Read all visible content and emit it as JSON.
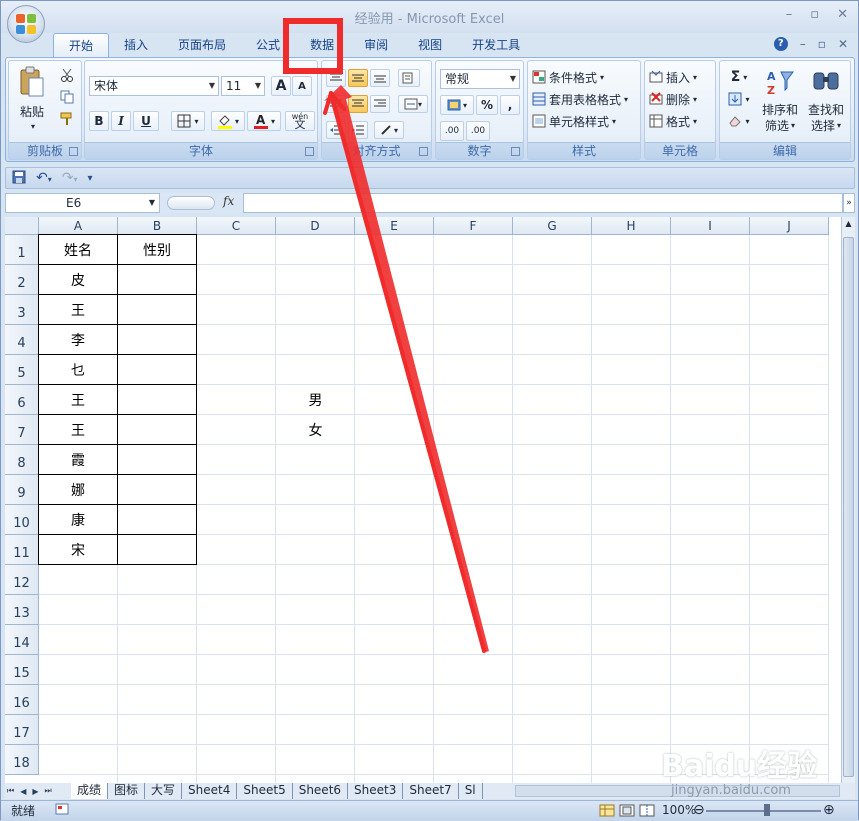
{
  "window": {
    "title": "经验用 - Microsoft Excel",
    "controls": [
      "–",
      "▫",
      "✕"
    ]
  },
  "ribbon_tabs": [
    "开始",
    "插入",
    "页面布局",
    "公式",
    "数据",
    "审阅",
    "视图",
    "开发工具"
  ],
  "ribbon": {
    "clipboard": {
      "label": "剪贴板",
      "paste": "粘贴"
    },
    "font": {
      "label": "字体",
      "font_name": "宋体",
      "font_size": "11",
      "grow": "A",
      "shrink": "A",
      "bold": "B",
      "italic": "I",
      "underline": "U",
      "phonetic": "wén",
      "phonetic_char": "文"
    },
    "alignment": {
      "label": "对齐方式"
    },
    "number": {
      "label": "数字",
      "format": "常规",
      "percent": "%",
      "comma": ",",
      "inc_decimal": ".00",
      "dec_decimal": ".00"
    },
    "styles": {
      "label": "样式",
      "conditional": "条件格式",
      "table": "套用表格格式",
      "cell_styles": "单元格样式"
    },
    "cells": {
      "label": "单元格",
      "insert": "插入",
      "delete": "删除",
      "format": "格式"
    },
    "editing": {
      "label": "编辑",
      "sum": "Σ",
      "sort": "排序和",
      "sort2": "筛选",
      "find": "查找和",
      "find2": "选择"
    }
  },
  "formula_bar": {
    "name_box": "E6",
    "fx": "fx",
    "value": ""
  },
  "columns": [
    "A",
    "B",
    "C",
    "D",
    "E",
    "F",
    "G",
    "H",
    "I",
    "J"
  ],
  "rows": [
    "1",
    "2",
    "3",
    "4",
    "5",
    "6",
    "7",
    "8",
    "9",
    "10",
    "11",
    "12",
    "13",
    "14",
    "15",
    "16",
    "17",
    "18"
  ],
  "cells": {
    "A1": "姓名",
    "B1": "性别",
    "A2": "皮",
    "A3": "王",
    "A4": "李",
    "A5": "乜",
    "A6": "王",
    "A7": "王",
    "A8": "霞",
    "A9": "娜",
    "A10": "康",
    "A11": "宋",
    "D6": "男",
    "D7": "女"
  },
  "sheet_tabs": [
    "成绩",
    "图标",
    "大写",
    "Sheet4",
    "Sheet5",
    "Sheet6",
    "Sheet3",
    "Sheet7",
    "Sl"
  ],
  "status": {
    "text": "就绪",
    "zoom": "100%"
  },
  "annotation": {
    "highlight_color": "#ef2b2b"
  },
  "watermark": {
    "brand": "Baidu经验",
    "url": "jingyan.baidu.com"
  }
}
